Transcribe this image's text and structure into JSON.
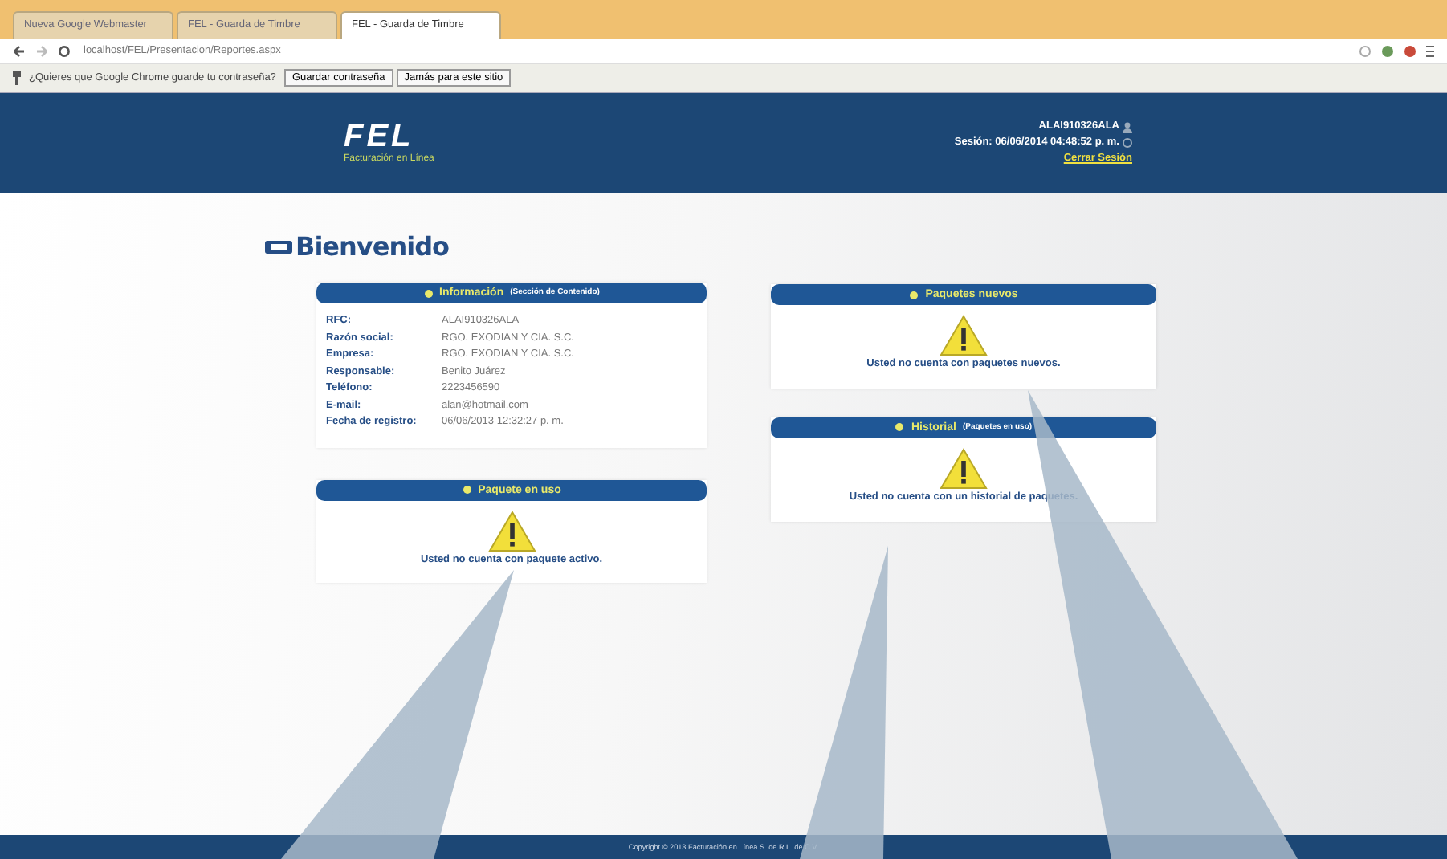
{
  "browser": {
    "tabs": [
      {
        "label": "Nueva Google Webmaster",
        "selected": false
      },
      {
        "label": "FEL - Guarda de Timbre",
        "selected": false
      },
      {
        "label": "FEL - Guarda de Timbre",
        "selected": true
      }
    ],
    "address": "localhost/FEL/Presentacion/Reportes.aspx",
    "password_bar": {
      "message": "¿Quieres que Google Chrome guarde tu contraseña?",
      "buttons": [
        "Guardar contraseña",
        "Jamás para este sitio"
      ]
    }
  },
  "header": {
    "logo": "FEL",
    "tagline": "Facturación en Línea",
    "user": "ALAI910326ALA",
    "session": "Sesión: 06/06/2014 04:48:52 p. m.",
    "logout": "Cerrar Sesión"
  },
  "page_title": "Bienvenido",
  "info_panel": {
    "title": "Información",
    "subtitle": "(Sección de Contenido)",
    "rows": [
      {
        "label": "RFC:",
        "value": "ALAI910326ALA"
      },
      {
        "label": "Razón social:",
        "value": "RGO. EXODIAN Y CIA. S.C."
      },
      {
        "label": "Empresa:",
        "value": "RGO. EXODIAN Y CIA. S.C."
      },
      {
        "label": "Responsable:",
        "value": "Benito Juárez"
      },
      {
        "label": "Teléfono:",
        "value": "2223456590"
      },
      {
        "label": "E-mail:",
        "value": "alan@hotmail.com"
      },
      {
        "label": "Fecha de registro:",
        "value": "06/06/2013 12:32:27 p. m."
      }
    ]
  },
  "panels": [
    {
      "title": "Paquete en uso",
      "message": "Usted no cuenta con paquete activo."
    },
    {
      "title": "Paquetes nuevos",
      "message": "Usted no cuenta con paquetes nuevos."
    },
    {
      "title": "Historial",
      "subtitle": "(Paquetes en uso)",
      "message": "Usted no cuenta con un historial de paquetes."
    }
  ],
  "footer": "Copyright © 2013 Facturación en Línea S. de R.L. de C.V."
}
